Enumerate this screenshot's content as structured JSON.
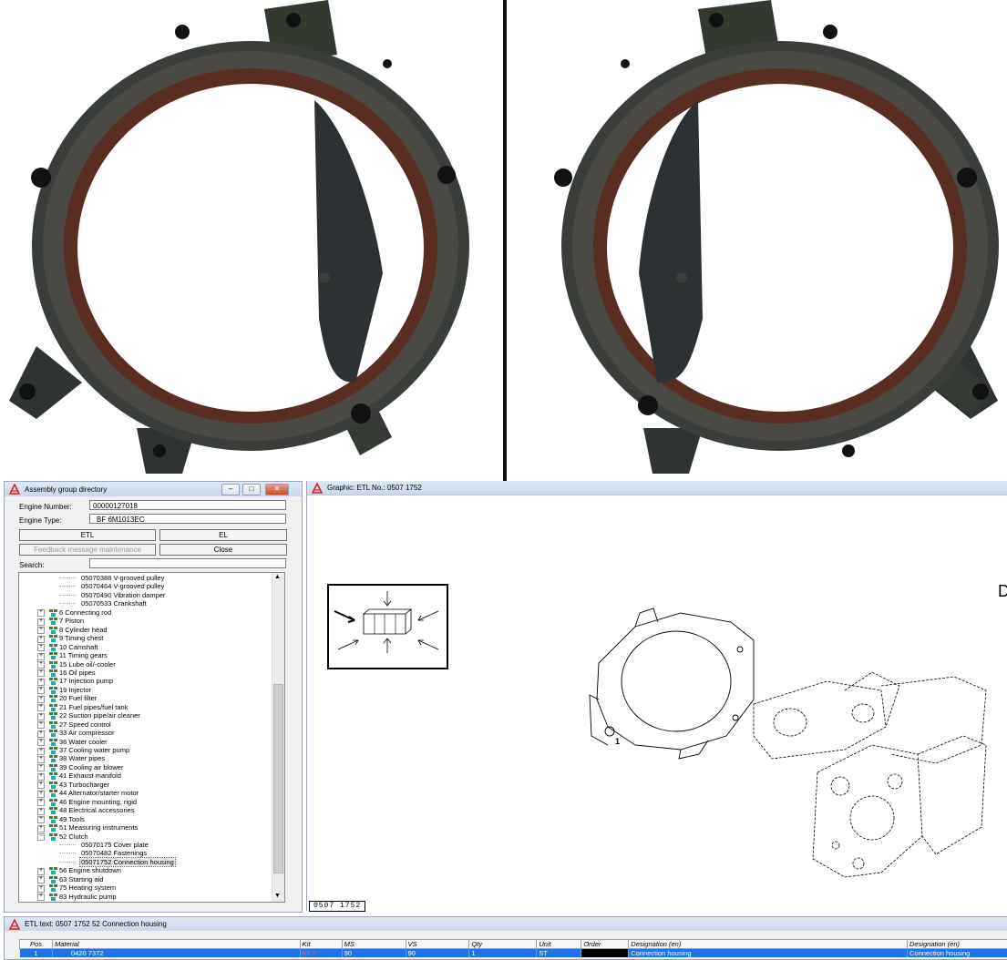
{
  "colors": {
    "selection": "#1e73e8",
    "kit_red": "#ff5a5a",
    "title_bar": "#c9d7ea"
  },
  "assembly_window": {
    "title": "Assembly group directory",
    "window_buttons": [
      "minimize-icon",
      "maximize-icon",
      "close-icon"
    ],
    "engine_number_label": "Engine Number:",
    "engine_number_value": "00000127018",
    "engine_type_label": "Engine Type:",
    "engine_type_value": "BF 6M1013EC",
    "etl_button": "ETL",
    "el_button": "EL",
    "feedback_button": "Feedback message maintenance",
    "close_button": "Close",
    "search_label": "Search:",
    "search_value": "",
    "tree": [
      {
        "label": "05070388  V-grooved pulley",
        "level": 2
      },
      {
        "label": "05070464  V-grooved pulley",
        "level": 2
      },
      {
        "label": "05070490  Vibration damper",
        "level": 2
      },
      {
        "label": "05070533  Crankshaft",
        "level": 2
      },
      {
        "label": "6  Connecting rod",
        "level": 1,
        "expanded": false,
        "icon": "assembly-icon"
      },
      {
        "label": "7  Piston",
        "level": 1,
        "expanded": false,
        "icon": "assembly-icon"
      },
      {
        "label": "8  Cylinder head",
        "level": 1,
        "expanded": false,
        "icon": "assembly-icon"
      },
      {
        "label": "9  Timing chest",
        "level": 1,
        "expanded": false,
        "icon": "assembly-icon"
      },
      {
        "label": "10  Camshaft",
        "level": 1,
        "expanded": false,
        "icon": "assembly-icon"
      },
      {
        "label": "11  Timing gears",
        "level": 1,
        "expanded": false,
        "icon": "assembly-icon"
      },
      {
        "label": "15  Lube oil/-cooler",
        "level": 1,
        "expanded": false,
        "icon": "assembly-icon"
      },
      {
        "label": "16  Oil pipes",
        "level": 1,
        "expanded": false,
        "icon": "assembly-icon"
      },
      {
        "label": "17  Injection pump",
        "level": 1,
        "expanded": false,
        "icon": "assembly-icon"
      },
      {
        "label": "19  Injector",
        "level": 1,
        "expanded": false,
        "icon": "assembly-icon"
      },
      {
        "label": "20  Fuel filter",
        "level": 1,
        "expanded": false,
        "icon": "assembly-icon"
      },
      {
        "label": "21  Fuel pipes/fuel tank",
        "level": 1,
        "expanded": false,
        "icon": "assembly-icon"
      },
      {
        "label": "22  Suction pipe/air cleaner",
        "level": 1,
        "expanded": false,
        "icon": "assembly-icon"
      },
      {
        "label": "27  Speed control",
        "level": 1,
        "expanded": false,
        "icon": "assembly-icon"
      },
      {
        "label": "33  Air compressor",
        "level": 1,
        "expanded": false,
        "icon": "assembly-icon"
      },
      {
        "label": "36  Water cooler",
        "level": 1,
        "expanded": false,
        "icon": "assembly-icon"
      },
      {
        "label": "37  Cooling water pump",
        "level": 1,
        "expanded": false,
        "icon": "assembly-icon"
      },
      {
        "label": "38  Water pipes",
        "level": 1,
        "expanded": false,
        "icon": "assembly-icon"
      },
      {
        "label": "39  Cooling air blower",
        "level": 1,
        "expanded": false,
        "icon": "assembly-icon"
      },
      {
        "label": "41  Exhaust manifold",
        "level": 1,
        "expanded": false,
        "icon": "assembly-icon"
      },
      {
        "label": "43  Turbocharger",
        "level": 1,
        "expanded": false,
        "icon": "assembly-icon"
      },
      {
        "label": "44  Alternator/starter motor",
        "level": 1,
        "expanded": false,
        "icon": "assembly-icon"
      },
      {
        "label": "46  Engine mounting, rigid",
        "level": 1,
        "expanded": false,
        "icon": "assembly-icon"
      },
      {
        "label": "48  Electrical accessories",
        "level": 1,
        "expanded": false,
        "icon": "assembly-icon"
      },
      {
        "label": "49  Tools",
        "level": 1,
        "expanded": false,
        "icon": "assembly-icon"
      },
      {
        "label": "51  Measuring instruments",
        "level": 1,
        "expanded": false,
        "icon": "assembly-icon"
      },
      {
        "label": "52  Clutch",
        "level": 1,
        "expanded": true,
        "icon": "assembly-icon"
      },
      {
        "label": "05070175  Cover plate",
        "level": 2
      },
      {
        "label": "05070482  Fastenings",
        "level": 2
      },
      {
        "label": "05071752  Connection housing",
        "level": 2,
        "selected": true
      },
      {
        "label": "56  Engine shutdown",
        "level": 1,
        "expanded": false,
        "icon": "assembly-icon"
      },
      {
        "label": "63  Starting aid",
        "level": 1,
        "expanded": false,
        "icon": "assembly-icon"
      },
      {
        "label": "75  Heating system",
        "level": 1,
        "expanded": false,
        "icon": "assembly-icon"
      },
      {
        "label": "83  Hydraulic pump",
        "level": 1,
        "expanded": false,
        "icon": "assembly-icon"
      }
    ]
  },
  "graphic_window": {
    "title": "Graphic: ETL No.: 0507 1752",
    "part_callout": "1",
    "drawing_number": "0507 1752",
    "edge_glyph": "D"
  },
  "etl_window": {
    "title": "ETL text: 0507 1752   52   Connection housing",
    "columns": [
      "Pos",
      "Material",
      "Kit",
      "MS",
      "VS",
      "Qty",
      "Unit",
      "Order",
      "Designation (en)",
      "Designation (en)"
    ],
    "rows": [
      [
        "1",
        "0420 7372",
        "Kit ?",
        "90",
        "90",
        "1",
        "ST",
        "",
        "Connection housing",
        "Connection housing"
      ]
    ]
  }
}
